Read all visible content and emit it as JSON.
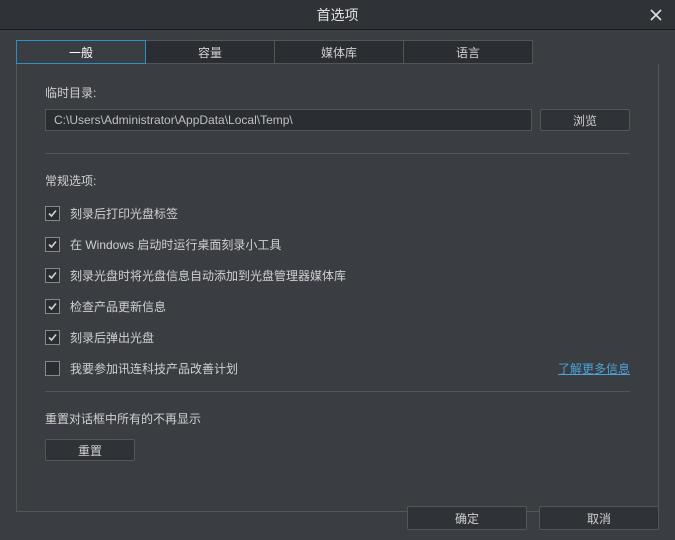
{
  "window": {
    "title": "首选项"
  },
  "tabs": {
    "general": "一般",
    "capacity": "容量",
    "media": "媒体库",
    "language": "语言"
  },
  "tempdir": {
    "label": "临时目录:",
    "value": "C:\\Users\\Administrator\\AppData\\Local\\Temp\\",
    "browse": "浏览"
  },
  "general": {
    "label": "常规选项:",
    "items": [
      {
        "label": "刻录后打印光盘标签",
        "checked": true
      },
      {
        "label": "在 Windows 启动时运行桌面刻录小工具",
        "checked": true
      },
      {
        "label": "刻录光盘时将光盘信息自动添加到光盘管理器媒体库",
        "checked": true
      },
      {
        "label": "检查产品更新信息",
        "checked": true
      },
      {
        "label": "刻录后弹出光盘",
        "checked": true
      },
      {
        "label": "我要参加讯连科技产品改善计划",
        "checked": false
      }
    ],
    "more_link": "了解更多信息"
  },
  "resetbox": {
    "label": "重置对话框中所有的不再显示",
    "button": "重置"
  },
  "buttons": {
    "ok": "确定",
    "cancel": "取消"
  }
}
